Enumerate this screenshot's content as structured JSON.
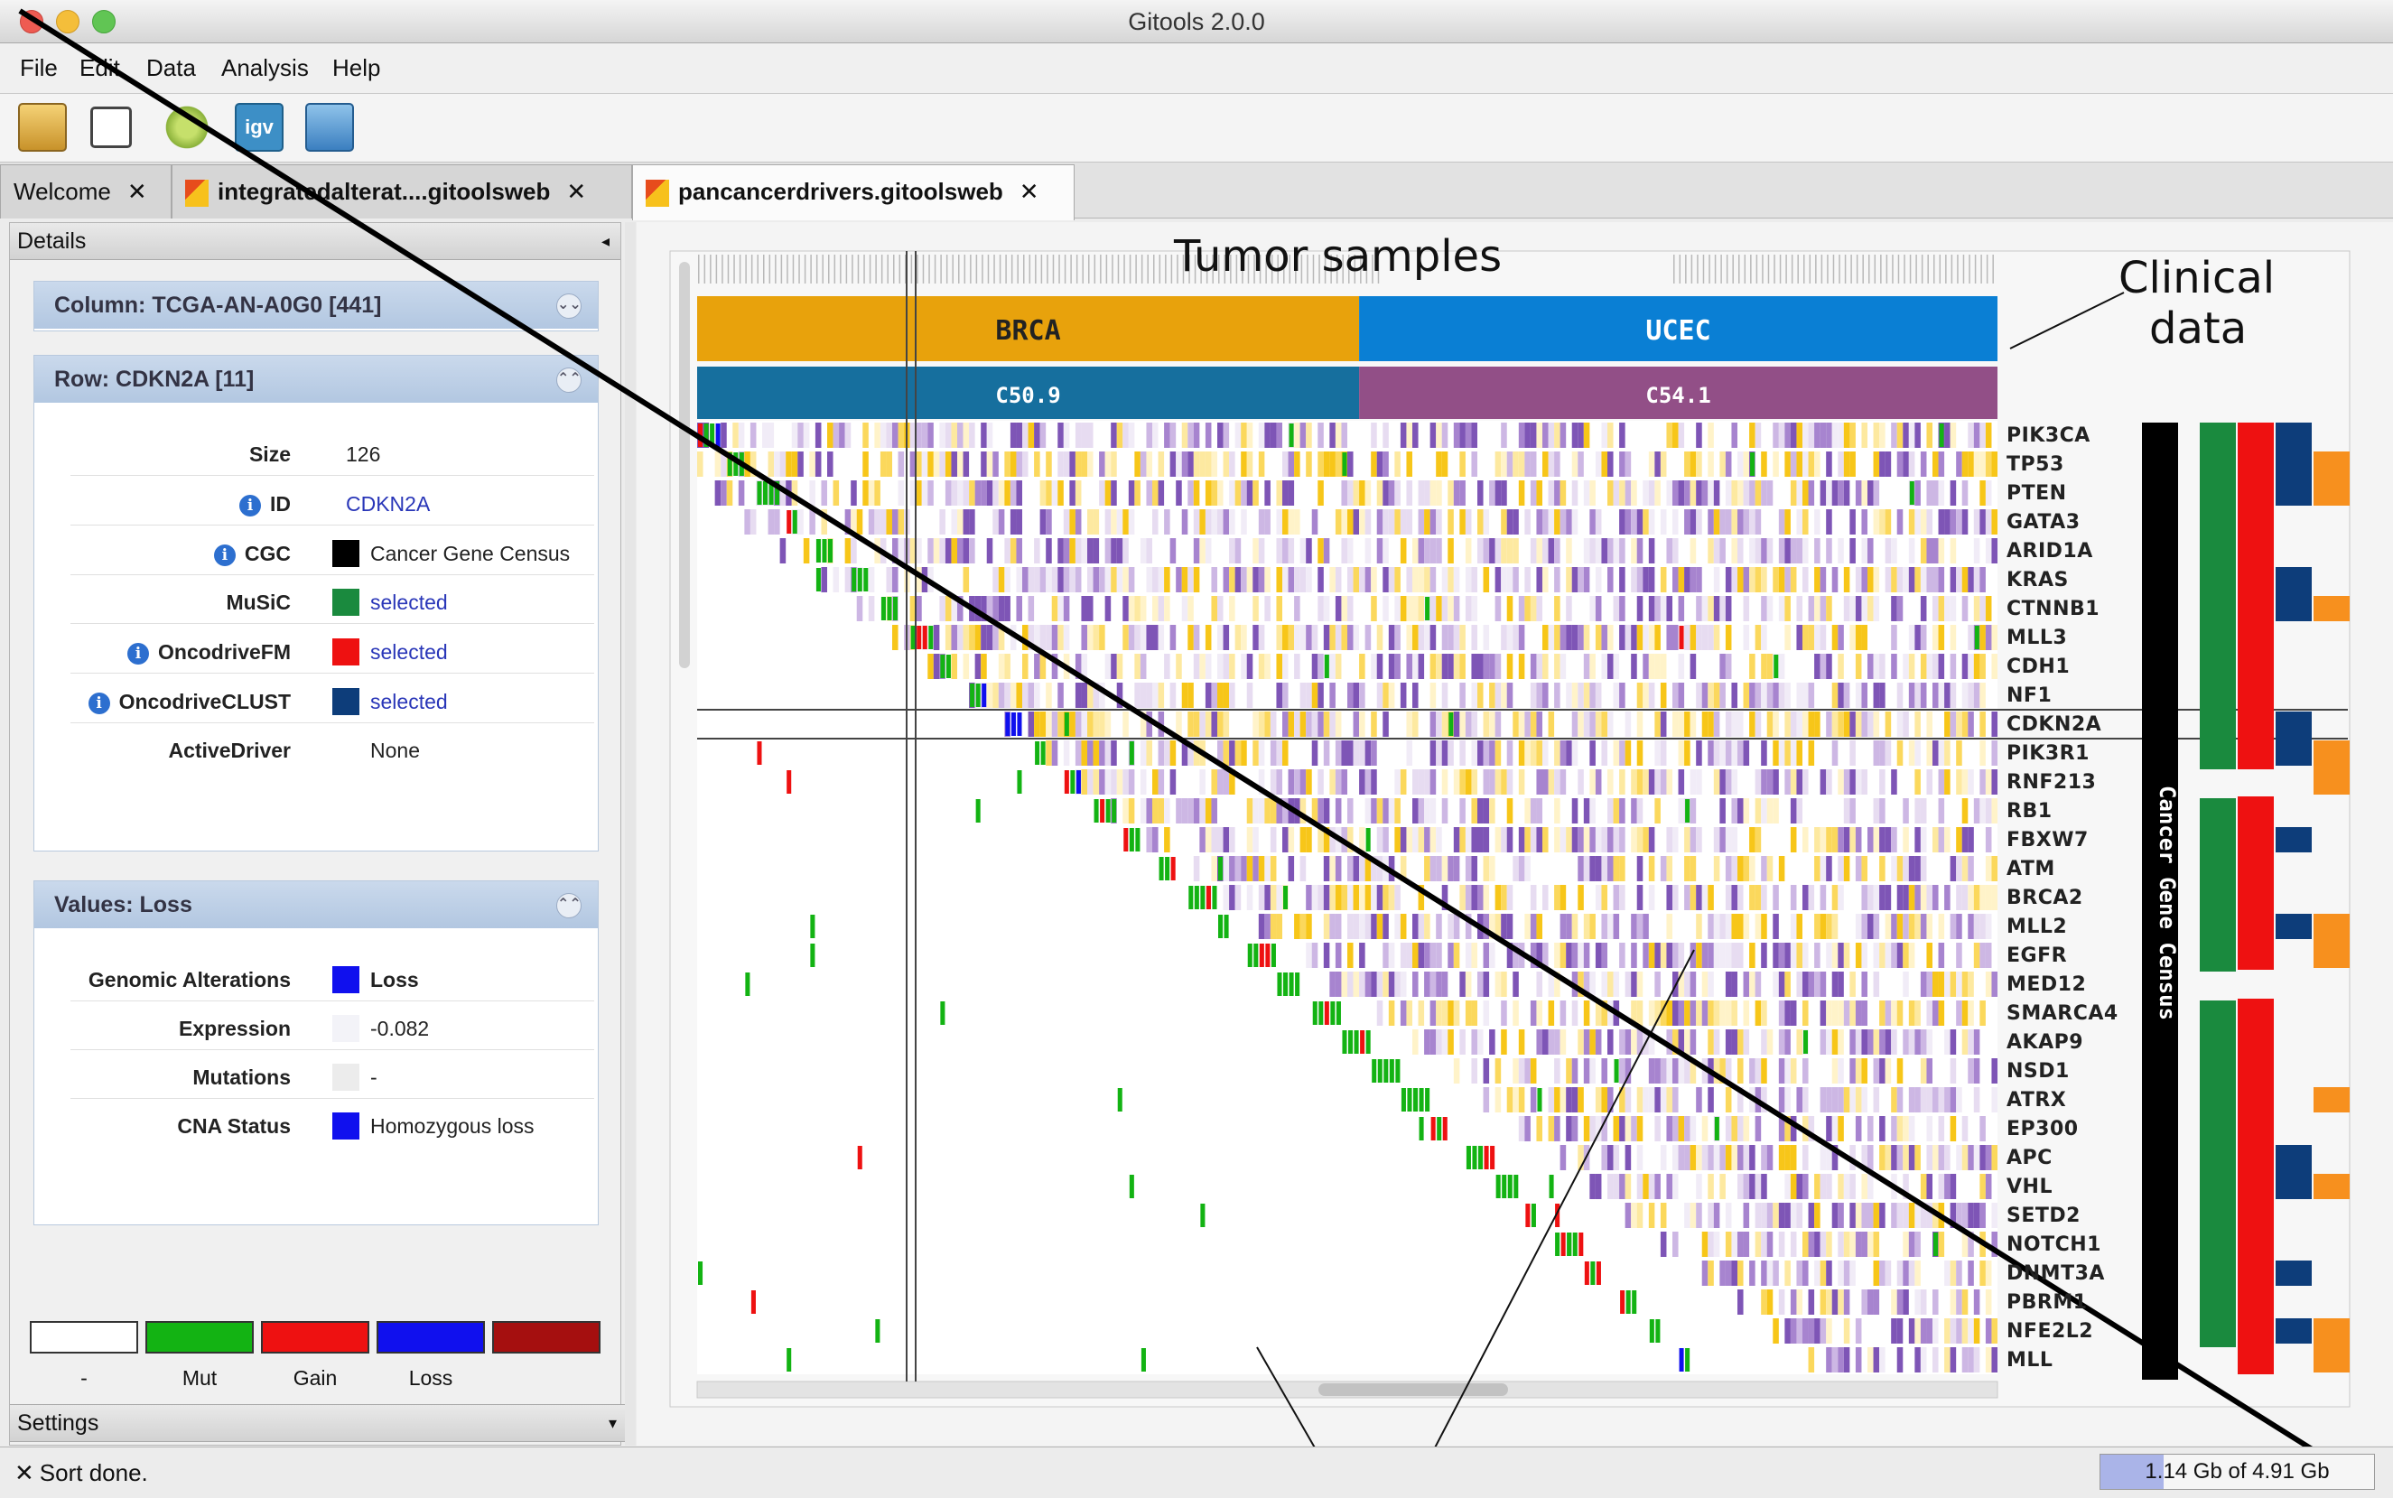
{
  "window": {
    "title": "Gitools 2.0.0"
  },
  "menu": [
    "File",
    "Edit",
    "Data",
    "Analysis",
    "Help"
  ],
  "toolbar": [
    "open-icon",
    "save-icon",
    "settings-icon",
    "igv-icon",
    "screenshot-icon"
  ],
  "tabs": [
    {
      "label": "Welcome",
      "close": "✕"
    },
    {
      "label": "integratedalterat....gitoolsweb",
      "close": "✕"
    },
    {
      "label": "pancancerdrivers.gitoolsweb",
      "close": "✕"
    }
  ],
  "details": {
    "header": "Details",
    "column_card": {
      "title": "Column: TCGA-AN-A0G0 [441]"
    },
    "row_card": {
      "title": "Row: CDKN2A [11]",
      "rows": [
        {
          "label": "Size",
          "value": "126"
        },
        {
          "label": "ID",
          "value": "CDKN2A"
        },
        {
          "label": "CGC",
          "value": "Cancer Gene Census",
          "color": "#000000"
        },
        {
          "label": "MuSiC",
          "value": "selected",
          "color": "#1a8a3e"
        },
        {
          "label": "OncodriveFM",
          "value": "selected",
          "color": "#ee1111"
        },
        {
          "label": "OncodriveCLUST",
          "value": "selected",
          "color": "#0d3d7a"
        },
        {
          "label": "ActiveDriver",
          "value": "None"
        }
      ]
    },
    "values_card": {
      "title": "Values: Loss",
      "rows": [
        {
          "label": "Genomic Alterations",
          "value": "Loss",
          "color": "#1010ee"
        },
        {
          "label": "Expression",
          "value": "-0.082",
          "color": "#f3f3f8"
        },
        {
          "label": "Mutations",
          "value": "-",
          "color": "#ececec"
        },
        {
          "label": "CNA Status",
          "value": "Homozygous loss",
          "color": "#1010ee"
        }
      ]
    },
    "legend": [
      {
        "label": "-",
        "color": "#ffffff"
      },
      {
        "label": "Mut",
        "color": "#13b313"
      },
      {
        "label": "Gain",
        "color": "#ee1111"
      },
      {
        "label": "Loss",
        "color": "#1010ee"
      },
      {
        "label": "",
        "color": "#a50f0f"
      }
    ],
    "settings": "Settings"
  },
  "heatmap": {
    "cancer_types": [
      {
        "label": "BRCA",
        "color": "#e8a20c"
      },
      {
        "label": "UCEC",
        "color": "#0a7fd4"
      }
    ],
    "icd_codes": [
      {
        "label": "C50.9",
        "color": "#166f9e"
      },
      {
        "label": "C54.1",
        "color": "#924f87"
      }
    ],
    "genes": [
      "PIK3CA",
      "TP53",
      "PTEN",
      "GATA3",
      "ARID1A",
      "KRAS",
      "CTNNB1",
      "MLL3",
      "CDH1",
      "NF1",
      "CDKN2A",
      "PIK3R1",
      "RNF213",
      "RB1",
      "FBXW7",
      "ATM",
      "BRCA2",
      "MLL2",
      "EGFR",
      "MED12",
      "SMARCA4",
      "AKAP9",
      "NSD1",
      "ATRX",
      "EP300",
      "APC",
      "VHL",
      "SETD2",
      "NOTCH1",
      "DNMT3A",
      "PBRM1",
      "NFE2L2",
      "MLL"
    ],
    "cgc_label": "Cancer Gene Census",
    "selected_gene": "CDKN2A"
  },
  "annotations": {
    "tumor_samples": "Tumor samples",
    "clinical": "Clinical",
    "data": "data"
  },
  "status": {
    "message": "Sort done.",
    "memory": "1.14 Gb of 4.91 Gb",
    "memory_fraction": 0.232
  }
}
